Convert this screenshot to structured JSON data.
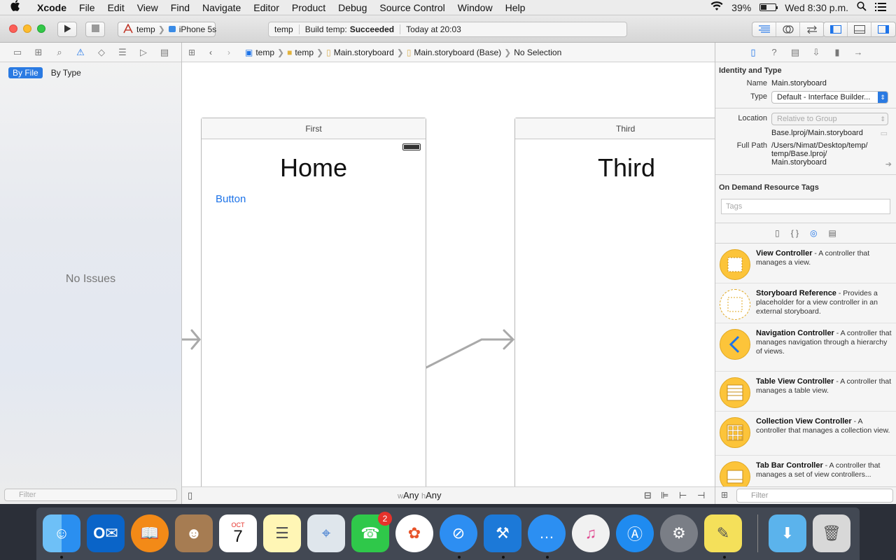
{
  "menubar": {
    "items": [
      "Xcode",
      "File",
      "Edit",
      "View",
      "Find",
      "Navigate",
      "Editor",
      "Product",
      "Debug",
      "Source Control",
      "Window",
      "Help"
    ],
    "battery_percent": "39%",
    "battery_level": 0.39,
    "clock": "Wed 8:30 p.m."
  },
  "toolbar": {
    "scheme_target": "temp",
    "scheme_device": "iPhone 5s",
    "activity_project": "temp",
    "activity_build_prefix": "Build temp:",
    "activity_build_status": "Succeeded",
    "activity_time": "Today at 20:03"
  },
  "navigator": {
    "filter_by_file": "By File",
    "filter_by_type": "By Type",
    "empty_message": "No Issues",
    "filter_placeholder": "Filter"
  },
  "jumpbar": {
    "crumbs": [
      "temp",
      "temp",
      "Main.storyboard",
      "Main.storyboard (Base)",
      "No Selection"
    ]
  },
  "canvas": {
    "scene_first_title": "First",
    "scene_first_heading": "Home",
    "scene_first_button": "Button",
    "scene_third_title": "Third",
    "scene_third_heading": "Third",
    "size_class_w_prefix": "w",
    "size_class_w": "Any",
    "size_class_h_prefix": "h",
    "size_class_h": "Any"
  },
  "inspector": {
    "identity_title": "Identity and Type",
    "name_label": "Name",
    "name_value": "Main.storyboard",
    "type_label": "Type",
    "type_value": "Default - Interface Builder...",
    "location_label": "Location",
    "location_value": "Relative to Group",
    "location_path": "Base.lproj/Main.storyboard",
    "fullpath_label": "Full Path",
    "fullpath_line1": "/Users/Nimat/Desktop/temp/",
    "fullpath_line2": "temp/Base.lproj/",
    "fullpath_line3": "Main.storyboard",
    "odr_title": "On Demand Resource Tags",
    "tags_placeholder": "Tags",
    "library": [
      {
        "title": "View Controller",
        "desc": " - A controller that manages a view."
      },
      {
        "title": "Storyboard Reference",
        "desc": " - Provides a placeholder for a view controller in an external storyboard."
      },
      {
        "title": "Navigation Controller",
        "desc": " - A controller that manages navigation through a hierarchy of views."
      },
      {
        "title": "Table View Controller",
        "desc": " - A controller that manages a table view."
      },
      {
        "title": "Collection View Controller",
        "desc": " - A controller that manages a collection view."
      },
      {
        "title": "Tab Bar Controller",
        "desc": " - A controller that manages a set of view controllers..."
      }
    ],
    "filter_placeholder": "Filter"
  },
  "dock": {
    "oct_label": "OCT",
    "date_number": "7",
    "facetime_badge": "2"
  },
  "colors": {
    "accent": "#1d73e8",
    "library_icon": "#fcc43a"
  }
}
